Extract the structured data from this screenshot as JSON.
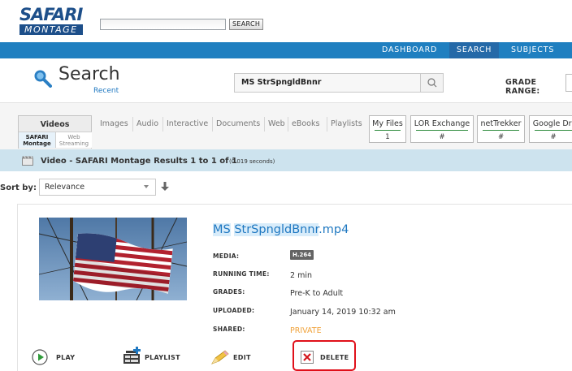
{
  "header": {
    "logo_top": "SAFARI",
    "logo_bottom": "MONTAGE",
    "search_button": "SEARCH"
  },
  "nav": {
    "items": [
      "DASHBOARD",
      "SEARCH",
      "SUBJECTS"
    ],
    "active": "SEARCH",
    "bar_color": "#1f7fc0"
  },
  "search": {
    "title": "Search",
    "recent": "Recent",
    "query": "MS StrSpngldBnnr",
    "grade_range_label": "GRADE RANGE:"
  },
  "tabs": {
    "videos": {
      "label": "Videos",
      "sub": [
        "SAFARI Montage",
        "Web Streaming"
      ]
    },
    "plain": [
      "Images",
      "Audio",
      "Interactive",
      "Documents",
      "Web",
      "eBooks",
      "Playlists"
    ],
    "boxed": [
      {
        "label": "My Files",
        "count": "1"
      },
      {
        "label": "LOR Exchange",
        "count": "#"
      },
      {
        "label": "netTrekker",
        "count": "#"
      },
      {
        "label": "Google Dri",
        "count": "#"
      }
    ]
  },
  "results": {
    "prefix": "Video - SAFARI Montage Results ",
    "range": "1 to 1 of 1",
    "time": "(0.019 seconds)"
  },
  "sort": {
    "label": "Sort by:",
    "value": "Relevance"
  },
  "item": {
    "title_part1": "MS",
    "title_part2": "StrSpngldBnnr",
    "title_ext": ".mp4",
    "media_label": "MEDIA:",
    "media_value": "H.264",
    "running_time_label": "RUNNING TIME:",
    "running_time_value": "2 min",
    "grades_label": "GRADES:",
    "grades_value": "Pre-K to Adult",
    "uploaded_label": "UPLOADED:",
    "uploaded_value": "January 14, 2019 10:32 am",
    "shared_label": "SHARED:",
    "shared_value": "PRIVATE"
  },
  "actions": {
    "play": "PLAY",
    "playlist": "PLAYLIST",
    "edit": "EDIT",
    "delete": "DELETE"
  }
}
